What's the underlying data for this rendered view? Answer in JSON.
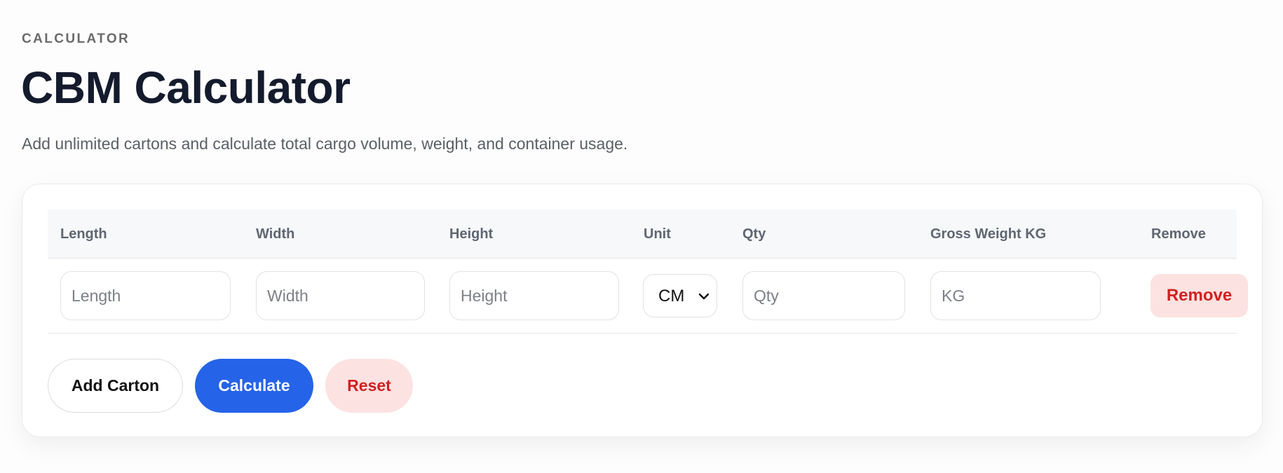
{
  "header": {
    "eyebrow": "CALCULATOR",
    "title": "CBM Calculator",
    "subtitle": "Add unlimited cartons and calculate total cargo volume, weight, and container usage."
  },
  "table": {
    "columns": [
      "Length",
      "Width",
      "Height",
      "Unit",
      "Qty",
      "Gross Weight KG",
      "Remove"
    ],
    "row": {
      "length": {
        "value": "",
        "placeholder": "Length"
      },
      "width": {
        "value": "",
        "placeholder": "Width"
      },
      "height": {
        "value": "",
        "placeholder": "Height"
      },
      "unit": {
        "selected": "CM",
        "icon": "chevron-down-icon"
      },
      "qty": {
        "value": "",
        "placeholder": "Qty"
      },
      "weight": {
        "value": "",
        "placeholder": "KG"
      },
      "remove_label": "Remove"
    }
  },
  "actions": {
    "add_label": "Add Carton",
    "calculate_label": "Calculate",
    "reset_label": "Reset"
  },
  "colors": {
    "primary": "#2563e9",
    "danger_text": "#d22121",
    "danger_bg": "#fde2e2",
    "heading": "#141b2d",
    "muted": "#5b5f66"
  }
}
